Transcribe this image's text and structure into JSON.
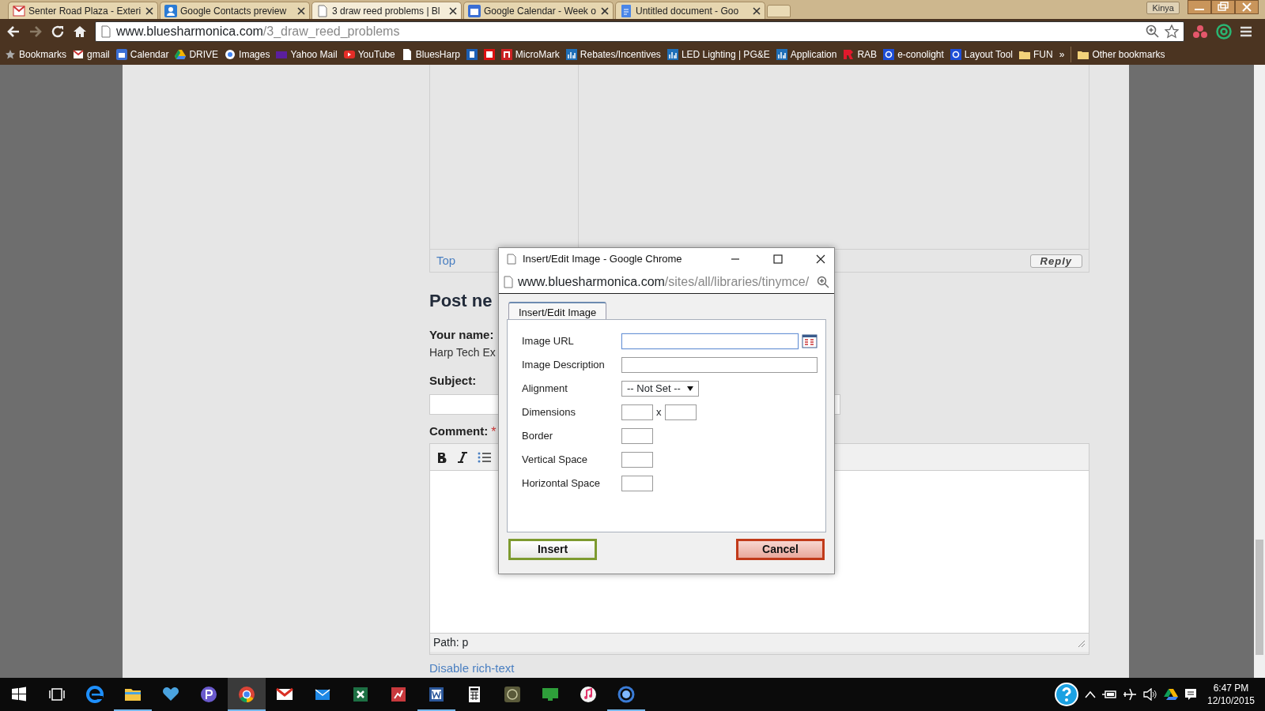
{
  "browser": {
    "tabs": [
      {
        "title": "Senter Road Plaza - Exteri",
        "selected": false
      },
      {
        "title": "Google Contacts preview",
        "selected": false
      },
      {
        "title": "3 draw reed problems | Bl",
        "selected": true
      },
      {
        "title": "Google Calendar - Week o",
        "selected": false
      },
      {
        "title": "Untitled document - Goo",
        "selected": false
      }
    ],
    "user": "Kinya",
    "address": {
      "domain": "www.bluesharmonica.com",
      "path": "/3_draw_reed_problems"
    },
    "bookmarks": [
      {
        "kind": "link",
        "label": "Bookmarks"
      },
      {
        "kind": "link",
        "label": "gmail"
      },
      {
        "kind": "link",
        "label": "Calendar"
      },
      {
        "kind": "link",
        "label": "DRIVE"
      },
      {
        "kind": "link",
        "label": "Images"
      },
      {
        "kind": "link",
        "label": "Yahoo Mail"
      },
      {
        "kind": "link",
        "label": "YouTube"
      },
      {
        "kind": "link",
        "label": "BluesHarp"
      },
      {
        "kind": "icon-only"
      },
      {
        "kind": "icon-only"
      },
      {
        "kind": "link",
        "label": "MicroMark"
      },
      {
        "kind": "link",
        "label": "Rebates/Incentives"
      },
      {
        "kind": "link",
        "label": "LED Lighting | PG&E"
      },
      {
        "kind": "link",
        "label": "Application"
      },
      {
        "kind": "link",
        "label": "RAB"
      },
      {
        "kind": "link",
        "label": "e-conolight"
      },
      {
        "kind": "link",
        "label": "Layout Tool"
      },
      {
        "kind": "link",
        "label": "FUN"
      }
    ],
    "more": "»",
    "other_bookmarks": "Other bookmarks"
  },
  "page": {
    "top_link": "Top",
    "reply": "Reply",
    "heading": "Post ne",
    "name_label": "Your name:",
    "name_value": "Harp Tech Ex",
    "subject_label": "Subject:",
    "comment_label": "Comment:",
    "required_mark": "*",
    "editor_path": "Path: p",
    "disable_link": "Disable rich-text"
  },
  "dialog": {
    "title": "Insert/Edit Image - Google Chrome",
    "url_domain": "www.bluesharmonica.com",
    "url_path": "/sites/all/libraries/tinymce/",
    "tab": {
      "label": "Insert/Edit Image",
      "selected": true
    },
    "fields": [
      {
        "label": "Image URL",
        "kind": "browse",
        "focused": true
      },
      {
        "label": "Image Description",
        "kind": "wide",
        "focused": false
      },
      {
        "label": "Alignment",
        "kind": "select",
        "value": "-- Not Set --",
        "focused": false
      },
      {
        "label": "Dimensions",
        "kind": "pair",
        "separator": "x",
        "focused": false
      },
      {
        "label": "Border",
        "kind": "small",
        "focused": false
      },
      {
        "label": "Vertical Space",
        "kind": "small",
        "focused": false
      },
      {
        "label": "Horizontal Space",
        "kind": "small",
        "focused": false
      }
    ],
    "buttons": [
      {
        "label": "Insert",
        "kind": "confirm"
      },
      {
        "label": "Cancel",
        "kind": "cancel"
      }
    ]
  },
  "taskbar": {
    "apps": [
      {
        "running": false,
        "active": false
      },
      {
        "running": false,
        "active": false
      },
      {
        "running": true,
        "active": false
      },
      {
        "running": false,
        "active": false
      },
      {
        "running": false,
        "active": false
      },
      {
        "running": true,
        "active": true
      },
      {
        "running": false,
        "active": false
      },
      {
        "running": false,
        "active": false
      },
      {
        "running": false,
        "active": false
      },
      {
        "running": false,
        "active": false
      },
      {
        "running": true,
        "active": false
      },
      {
        "running": false,
        "active": false
      },
      {
        "running": false,
        "active": false
      },
      {
        "running": false,
        "active": false
      },
      {
        "running": false,
        "active": false
      },
      {
        "running": true,
        "active": false
      }
    ],
    "time": "6:47 PM",
    "date": "12/10/2015"
  }
}
